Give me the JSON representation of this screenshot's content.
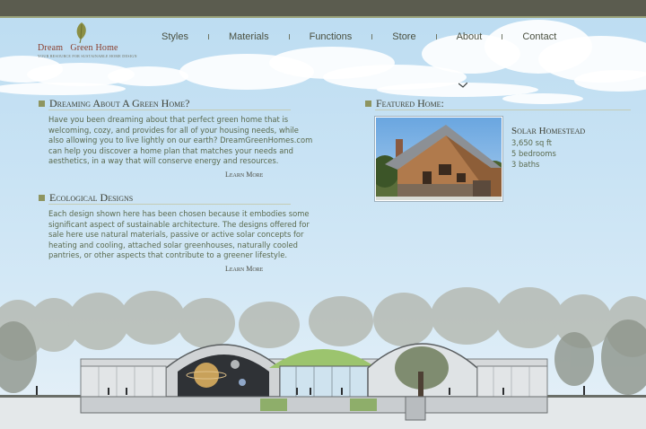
{
  "brand": {
    "name": "Dream Green Home",
    "name_left": "Dream",
    "name_right": "Green Home",
    "tagline": "YOUR RESOURCE FOR SUSTAINABLE HOME DESIGN"
  },
  "nav": {
    "items": [
      {
        "label": "Styles"
      },
      {
        "label": "Materials"
      },
      {
        "label": "Functions"
      },
      {
        "label": "Store"
      },
      {
        "label": "About"
      },
      {
        "label": "Contact"
      }
    ]
  },
  "sections": {
    "dreaming": {
      "title": "Dreaming About A Green Home?",
      "body": "Have you been dreaming about that perfect green home that is welcoming, cozy, and provides for all of your housing needs, while also allowing you to live lightly on our earth? DreamGreenHomes.com can help you discover a home plan that matches your needs and aesthetics, in a way that will conserve energy and resources.",
      "link": "Learn More"
    },
    "ecological": {
      "title": "Ecological Designs",
      "body": "Each design shown here has been chosen because it embodies some significant aspect of sustainable architecture. The designs offered for sale here use natural materials, passive or active solar concepts for heating and cooling, attached solar greenhouses, naturally cooled pantries, or other aspects that contribute to a greener lifestyle.",
      "link": "Learn More"
    },
    "featured": {
      "title": "Featured Home:",
      "home_name": "Solar Homestead",
      "size": "3,650 sq ft",
      "bedrooms": "5 bedrooms",
      "baths": "3 baths"
    }
  },
  "colors": {
    "top_bar": "#5b5c4f",
    "accent_olive": "#8e9560",
    "text_green": "#5a6a4e",
    "brand_red": "#8a3d2c"
  }
}
